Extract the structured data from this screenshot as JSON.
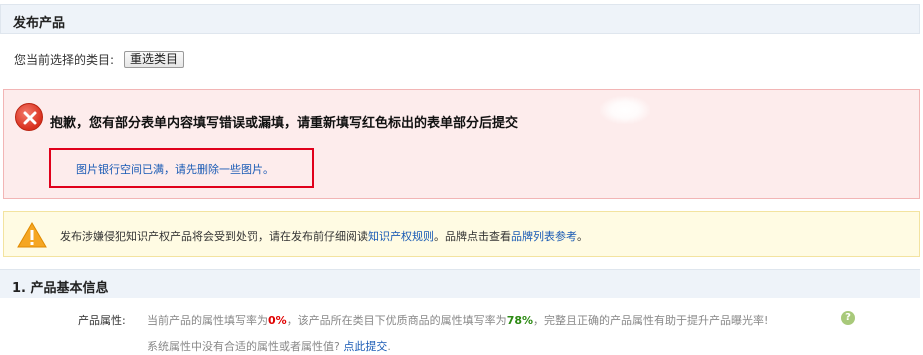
{
  "header": {
    "title": "发布产品",
    "category_label": "您当前选择的类目:",
    "reselect_label": "重选类目"
  },
  "error": {
    "title": "抱歉，您有部分表单内容填写错误或漏填，请重新填写红色标出的表单部分后提交",
    "message": "图片银行空间已满，请先删除一些图片。",
    "icon": "error-x-icon",
    "highlight_color": "#e0001b"
  },
  "warning": {
    "icon": "warning-triangle-icon",
    "text_before": "发布涉嫌侵犯知识产权产品将会受到处罚，请在发布前仔细阅读",
    "link1": "知识产权规则",
    "text_middle": "。品牌点击查看",
    "link2": "品牌列表参考",
    "text_after": "。"
  },
  "section": {
    "title": "1. 产品基本信息"
  },
  "attributes": {
    "label": "产品属性:",
    "text_before": "当前产品的属性填写率为",
    "fill_rate": "0%",
    "text_middle": "，该产品所在类目下优质商品的属性填写率为",
    "quality_rate": "78%",
    "text_after": "，完整且正确的产品属性有助于提升产品曝光率!",
    "help_icon_text": "?",
    "line2_text": "系统属性中没有合适的属性或者属性值?",
    "line2_link": "点此提交",
    "line2_end": "."
  }
}
